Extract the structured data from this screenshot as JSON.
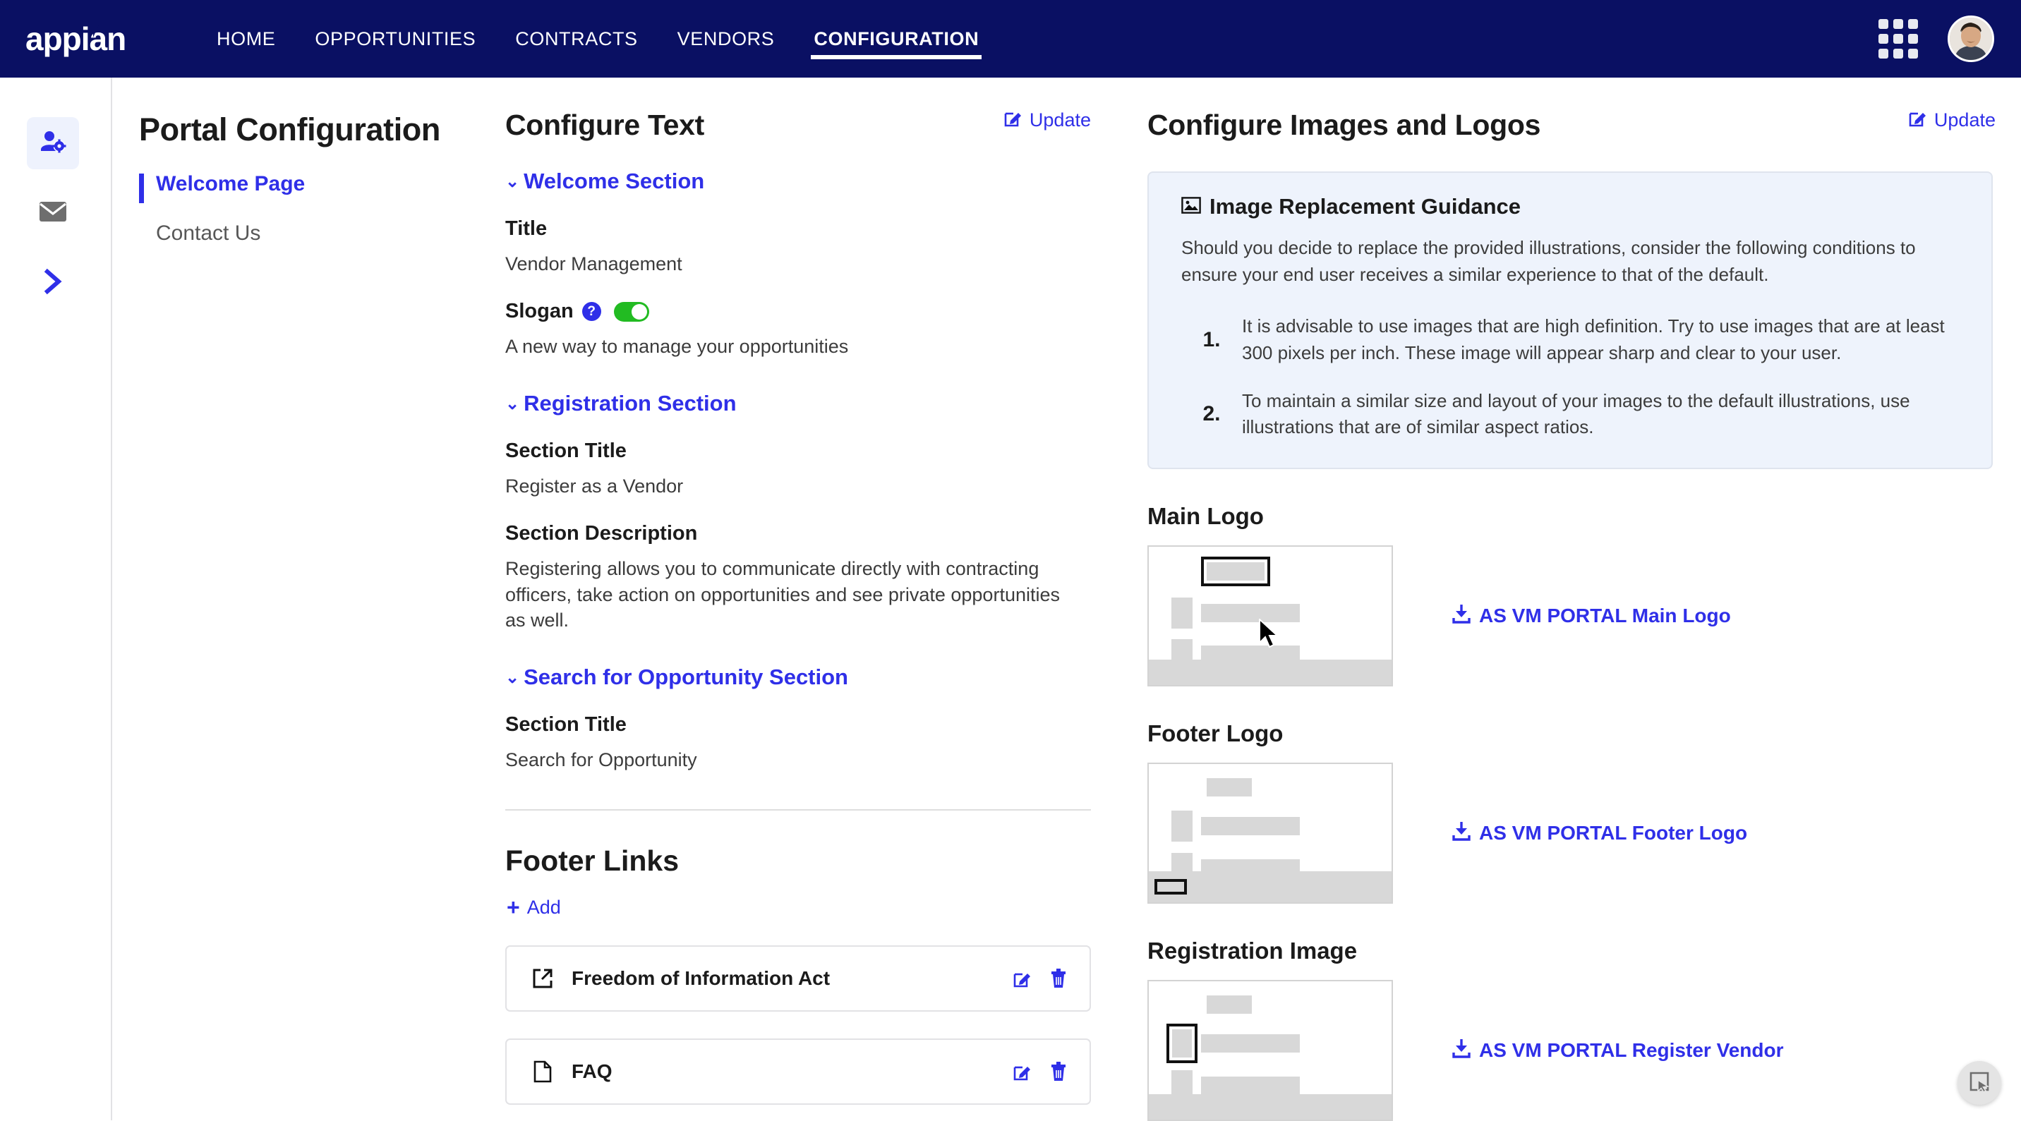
{
  "header": {
    "brand": "appian",
    "nav": [
      {
        "label": "HOME",
        "active": false
      },
      {
        "label": "OPPORTUNITIES",
        "active": false
      },
      {
        "label": "CONTRACTS",
        "active": false
      },
      {
        "label": "VENDORS",
        "active": false
      },
      {
        "label": "CONFIGURATION",
        "active": true
      }
    ],
    "grid_icon": "apps-grid-icon",
    "avatar": "user-avatar"
  },
  "rail": {
    "items": [
      {
        "icon": "user-settings-icon",
        "active": true
      },
      {
        "icon": "envelope-icon",
        "active": false
      },
      {
        "icon": "chevron-right-icon",
        "active": false
      }
    ]
  },
  "sidebar": {
    "title": "Portal Configuration",
    "items": [
      {
        "label": "Welcome Page",
        "active": true
      },
      {
        "label": "Contact Us",
        "active": false
      }
    ]
  },
  "configure_text": {
    "title": "Configure Text",
    "update_label": "Update",
    "update_icon": "edit-pencil-icon",
    "sections": [
      {
        "name": "Welcome Section",
        "fields": [
          {
            "label": "Title",
            "value": "Vendor Management"
          },
          {
            "label": "Slogan",
            "value": "A new way to manage your opportunities",
            "help_icon": "question-mark-icon",
            "toggle": "on",
            "toggle_color": "#22bb22"
          }
        ]
      },
      {
        "name": "Registration Section",
        "fields": [
          {
            "label": "Section Title",
            "value": "Register as a Vendor"
          },
          {
            "label": "Section Description",
            "value": "Registering allows you to communicate directly with contracting officers, take action on opportunities and see private opportunities as well."
          }
        ]
      },
      {
        "name": "Search for Opportunity Section",
        "fields": [
          {
            "label": "Section Title",
            "value": "Search for Opportunity"
          }
        ]
      }
    ]
  },
  "footer_links": {
    "title": "Footer Links",
    "add_label": "Add",
    "add_icon": "plus-icon",
    "items": [
      {
        "label": "Freedom of Information Act",
        "icon": "external-link-icon",
        "edit_icon": "edit-pencil-icon",
        "delete_icon": "trash-icon"
      },
      {
        "label": "FAQ",
        "icon": "document-icon",
        "edit_icon": "edit-pencil-icon",
        "delete_icon": "trash-icon"
      }
    ]
  },
  "configure_images": {
    "title": "Configure Images and Logos",
    "update_label": "Update",
    "update_icon": "edit-pencil-icon",
    "guidance": {
      "title": "Image Replacement Guidance",
      "icon": "image-icon",
      "intro": "Should you decide to replace the provided illustrations, consider the following conditions to ensure your end user receives a similar experience to that of the default.",
      "items": [
        {
          "number": "1.",
          "text": "It is advisable to use images that are high definition. Try to use images that are at least 300 pixels per inch. These image will appear sharp and clear to your user."
        },
        {
          "number": "2.",
          "text": "To maintain a similar size and layout of your images to the default illustrations, use illustrations that are of similar aspect ratios."
        }
      ]
    },
    "assets": [
      {
        "title": "Main Logo",
        "link_label": "AS VM PORTAL Main Logo",
        "link_icon": "download-icon",
        "highlight": "top-center"
      },
      {
        "title": "Footer Logo",
        "link_label": "AS VM PORTAL Footer Logo",
        "link_icon": "download-icon",
        "highlight": "footer-bar"
      },
      {
        "title": "Registration Image",
        "link_label": "AS VM PORTAL Register Vendor",
        "link_icon": "download-icon",
        "highlight": "left-block"
      }
    ]
  },
  "fab": {
    "icon": "select-region-icon"
  },
  "colors": {
    "nav_bg": "#0a1063",
    "accent_blue": "#2f2fe8",
    "toggle_green": "#22bb22",
    "guidance_bg": "#eef3fc",
    "rail_active_bg": "#eef2fd"
  }
}
